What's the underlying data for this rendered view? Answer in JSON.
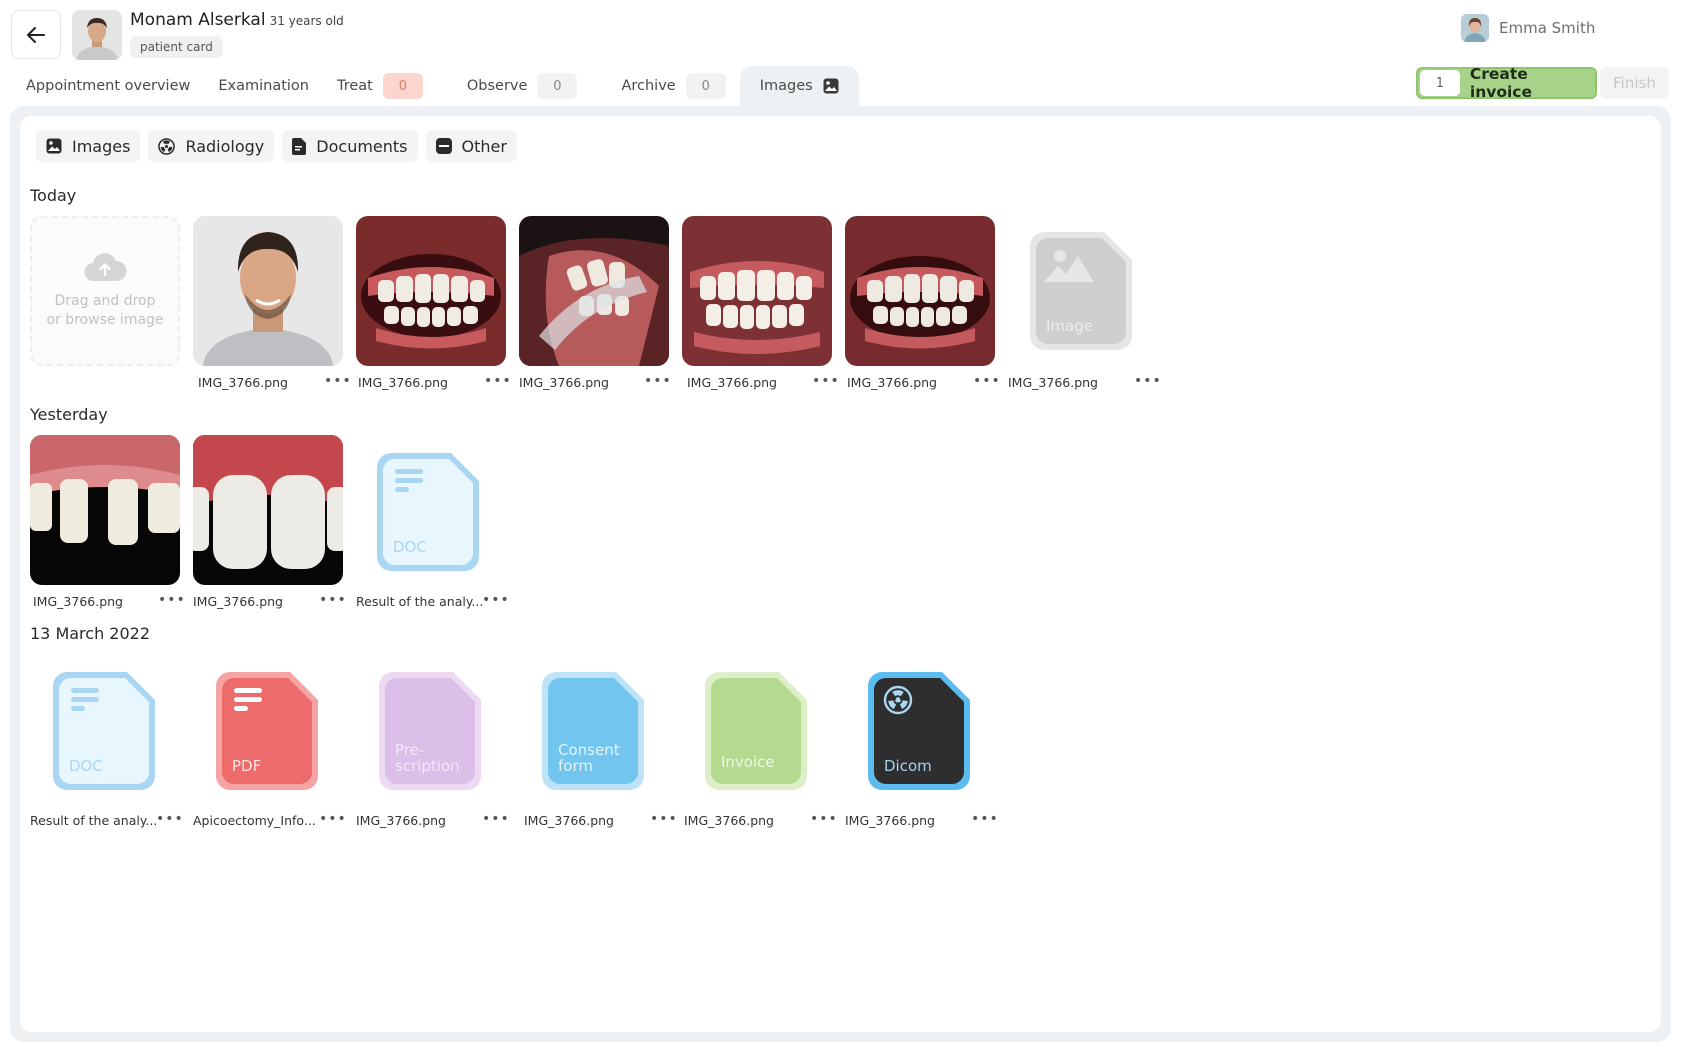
{
  "patient": {
    "name": "Monam Alserkal",
    "age": "31 years old",
    "badge": "patient card"
  },
  "user": {
    "name": "Emma Smith"
  },
  "tabs": [
    {
      "label": "Appointment overview"
    },
    {
      "label": "Examination"
    },
    {
      "label": "Treat",
      "count": "0"
    },
    {
      "label": "Observe",
      "count": "0"
    },
    {
      "label": "Archive",
      "count": "0"
    },
    {
      "label": "Images"
    }
  ],
  "actions": {
    "invoice_count": "1",
    "invoice_label": "Create invoice",
    "finish_label": "Finish"
  },
  "filters": [
    {
      "label": "Images",
      "icon": "image-icon"
    },
    {
      "label": "Radiology",
      "icon": "radiation-icon"
    },
    {
      "label": "Documents",
      "icon": "document-icon"
    },
    {
      "label": "Other",
      "icon": "folder-icon"
    }
  ],
  "sections": {
    "today": {
      "title": "Today",
      "upload_text_1": "Drag and drop",
      "upload_text_2": "or browse image",
      "placeholder_label": "Image",
      "items": [
        "IMG_3766.png",
        "IMG_3766.png",
        "IMG_3766.png",
        "IMG_3766.png",
        "IMG_3766.png",
        "IMG_3766.png"
      ]
    },
    "yesterday": {
      "title": "Yesterday",
      "doc_label": "DOC",
      "items": [
        "IMG_3766.png",
        "IMG_3766.png",
        "Result of the analy..."
      ]
    },
    "march": {
      "title": "13 March 2022",
      "labels": {
        "doc": "DOC",
        "pdf": "PDF",
        "presc_1": "Pre-",
        "presc_2": "scription",
        "consent_1": "Consent",
        "consent_2": "form",
        "invoice": "Invoice",
        "dicom": "Dicom"
      },
      "items": [
        "Result of the analy...",
        "Apicoectomy_Info...",
        "IMG_3766.png",
        "IMG_3766.png",
        "IMG_3766.png",
        "IMG_3766.png"
      ]
    }
  },
  "more_label": "•••",
  "colors": {
    "accent_green": "#a6d28a",
    "doc_blue": "#9fd0f1",
    "pdf_red": "#ee6b6b",
    "dicom_dark": "#2e2e2e"
  }
}
